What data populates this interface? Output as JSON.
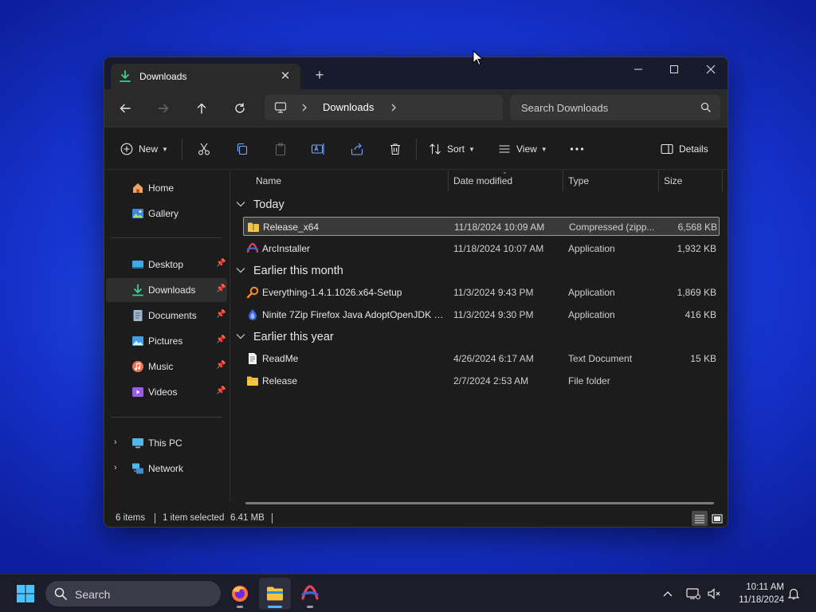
{
  "window": {
    "tab_title": "Downloads",
    "new_tab_symbol": "+",
    "close_tab_symbol": "✕"
  },
  "nav": {
    "breadcrumb": [
      "Downloads"
    ],
    "search_placeholder": "Search Downloads"
  },
  "toolbar": {
    "new_label": "New",
    "sort_label": "Sort",
    "view_label": "View",
    "details_label": "Details",
    "icons": [
      "cut-icon",
      "copy-icon",
      "paste-icon",
      "rename-icon",
      "share-icon",
      "delete-icon",
      "more-icon"
    ]
  },
  "sidebar": {
    "top": [
      {
        "label": "Home",
        "icon": "home-icon"
      },
      {
        "label": "Gallery",
        "icon": "gallery-icon"
      }
    ],
    "pinned": [
      {
        "label": "Desktop",
        "icon": "desktop-folder-icon"
      },
      {
        "label": "Downloads",
        "icon": "downloads-folder-icon",
        "selected": true
      },
      {
        "label": "Documents",
        "icon": "documents-folder-icon"
      },
      {
        "label": "Pictures",
        "icon": "pictures-folder-icon"
      },
      {
        "label": "Music",
        "icon": "music-folder-icon"
      },
      {
        "label": "Videos",
        "icon": "videos-folder-icon"
      }
    ],
    "bottom": [
      {
        "label": "This PC",
        "icon": "this-pc-icon"
      },
      {
        "label": "Network",
        "icon": "network-icon"
      }
    ]
  },
  "columns": {
    "name": "Name",
    "date": "Date modified",
    "type": "Type",
    "size": "Size"
  },
  "groups": [
    {
      "title": "Today",
      "rows": [
        {
          "name": "Release_x64",
          "date": "11/18/2024 10:09 AM",
          "type": "Compressed (zipp...",
          "size": "6,568 KB",
          "icon": "zip-folder-icon",
          "selected": true
        },
        {
          "name": "ArcInstaller",
          "date": "11/18/2024 10:07 AM",
          "type": "Application",
          "size": "1,932 KB",
          "icon": "arc-app-icon"
        }
      ]
    },
    {
      "title": "Earlier this month",
      "rows": [
        {
          "name": "Everything-1.4.1.1026.x64-Setup",
          "date": "11/3/2024 9:43 PM",
          "type": "Application",
          "size": "1,869 KB",
          "icon": "everything-app-icon"
        },
        {
          "name": "Ninite 7Zip Firefox Java AdoptOpenJDK x...",
          "date": "11/3/2024 9:30 PM",
          "type": "Application",
          "size": "416 KB",
          "icon": "ninite-app-icon"
        }
      ]
    },
    {
      "title": "Earlier this year",
      "rows": [
        {
          "name": "ReadMe",
          "date": "4/26/2024 6:17 AM",
          "type": "Text Document",
          "size": "15 KB",
          "icon": "text-file-icon"
        },
        {
          "name": "Release",
          "date": "2/7/2024 2:53 AM",
          "type": "File folder",
          "size": "",
          "icon": "folder-icon"
        }
      ]
    }
  ],
  "status": {
    "items": "6 items",
    "selection": "1 item selected",
    "size": "6.41 MB"
  },
  "taskbar": {
    "search_placeholder": "Search",
    "apps": [
      "firefox-icon",
      "file-explorer-icon",
      "arc-icon"
    ],
    "time": "10:11 AM",
    "date": "11/18/2024"
  },
  "colors": {
    "accent": "#5ab0ff",
    "folder": "#f4c542",
    "download_green": "#3ecf8e"
  }
}
